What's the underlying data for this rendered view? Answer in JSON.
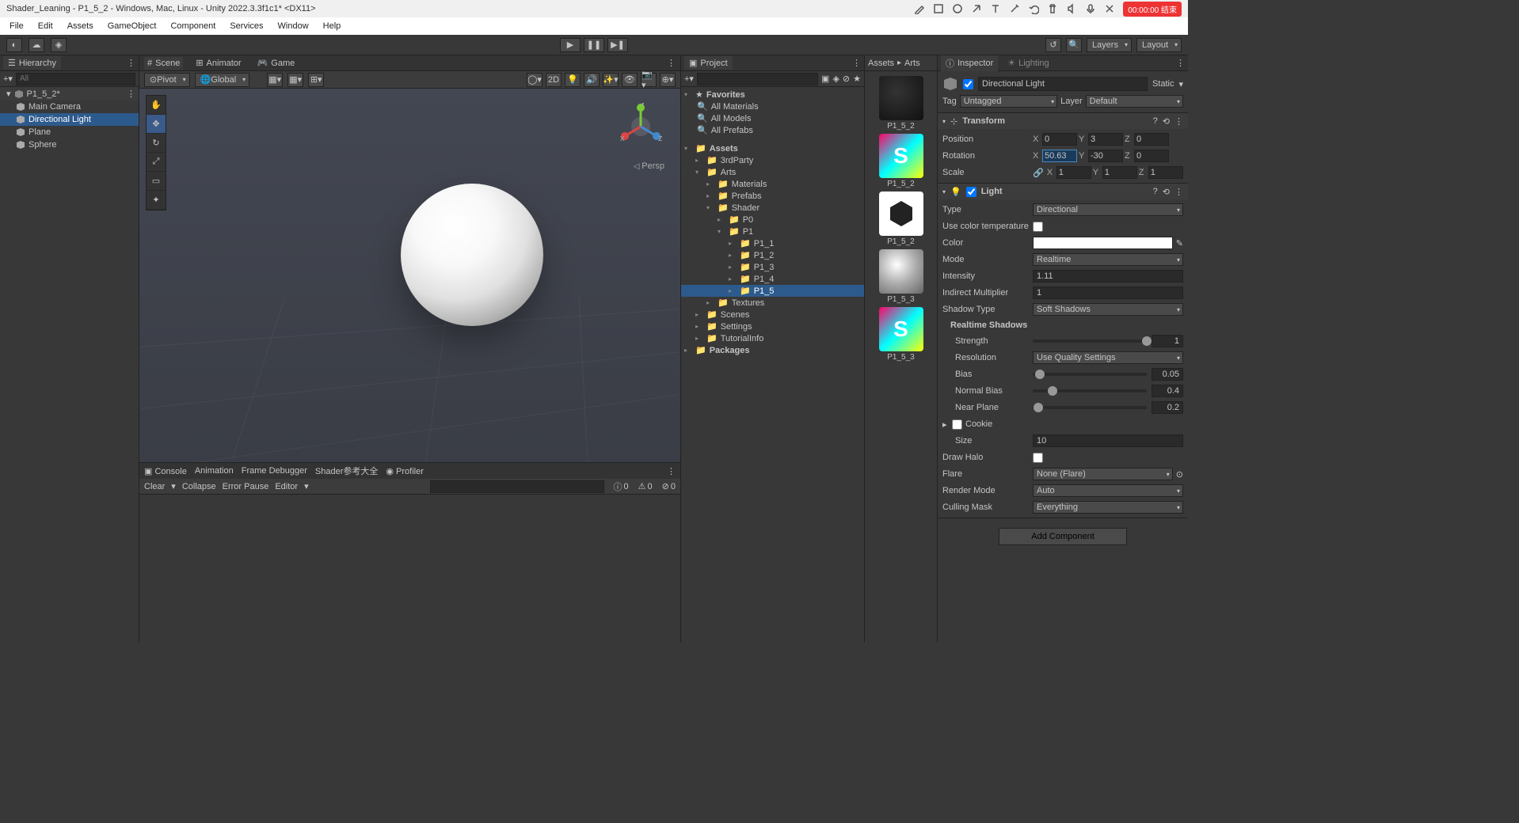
{
  "title": "Shader_Leaning - P1_5_2 - Windows, Mac, Linux - Unity 2022.3.3f1c1* <DX11>",
  "rec": "00:00:00 结束",
  "menu": [
    "File",
    "Edit",
    "Assets",
    "GameObject",
    "Component",
    "Services",
    "Window",
    "Help"
  ],
  "toolbar": {
    "layers": "Layers",
    "layout": "Layout"
  },
  "hierarchy": {
    "tab": "Hierarchy",
    "search": "All",
    "scene": "P1_5_2*",
    "items": [
      "Main Camera",
      "Directional Light",
      "Plane",
      "Sphere"
    ],
    "selected": 1
  },
  "scene": {
    "tabs": [
      "Scene",
      "Animator",
      "Game"
    ],
    "pivot": "Pivot",
    "global": "Global",
    "mode2d": "2D",
    "persp": "Persp"
  },
  "console": {
    "tabs": [
      "Console",
      "Animation",
      "Frame Debugger",
      "Shader参考大全",
      "Profiler"
    ],
    "btns": [
      "Clear",
      "Collapse",
      "Error Pause",
      "Editor"
    ],
    "counts": {
      "info": "0",
      "warn": "0",
      "error": "0"
    }
  },
  "project": {
    "tab": "Project",
    "favorites": "Favorites",
    "fav_items": [
      "All Materials",
      "All Models",
      "All Prefabs"
    ],
    "assets": "Assets",
    "tree": [
      {
        "name": "3rdParty",
        "depth": 1
      },
      {
        "name": "Arts",
        "depth": 1,
        "open": true
      },
      {
        "name": "Materials",
        "depth": 2
      },
      {
        "name": "Prefabs",
        "depth": 2
      },
      {
        "name": "Shader",
        "depth": 2,
        "open": true
      },
      {
        "name": "P0",
        "depth": 3
      },
      {
        "name": "P1",
        "depth": 3,
        "open": true
      },
      {
        "name": "P1_1",
        "depth": 4
      },
      {
        "name": "P1_2",
        "depth": 4
      },
      {
        "name": "P1_3",
        "depth": 4
      },
      {
        "name": "P1_4",
        "depth": 4
      },
      {
        "name": "P1_5",
        "depth": 4,
        "sel": true
      },
      {
        "name": "Textures",
        "depth": 2
      },
      {
        "name": "Scenes",
        "depth": 1
      },
      {
        "name": "Settings",
        "depth": 1
      },
      {
        "name": "TutorialInfo",
        "depth": 1
      }
    ],
    "packages": "Packages"
  },
  "thumbs": {
    "breadcrumb": [
      "Assets",
      "Arts"
    ],
    "items": [
      "P1_5_2",
      "P1_5_2",
      "P1_5_2",
      "P1_5_3",
      "P1_5_3"
    ]
  },
  "inspector": {
    "tab": "Inspector",
    "lighting_tab": "Lighting",
    "name": "Directional Light",
    "static": "Static",
    "tag_label": "Tag",
    "tag": "Untagged",
    "layer_label": "Layer",
    "layer": "Default",
    "transform": {
      "title": "Transform",
      "position": {
        "label": "Position",
        "x": "0",
        "y": "3",
        "z": "0"
      },
      "rotation": {
        "label": "Rotation",
        "x": "50.63",
        "y": "-30",
        "z": "0"
      },
      "scale": {
        "label": "Scale",
        "x": "1",
        "y": "1",
        "z": "1"
      }
    },
    "light": {
      "title": "Light",
      "type": {
        "label": "Type",
        "value": "Directional"
      },
      "use_color_temp": {
        "label": "Use color temperature"
      },
      "color": {
        "label": "Color"
      },
      "mode": {
        "label": "Mode",
        "value": "Realtime"
      },
      "intensity": {
        "label": "Intensity",
        "value": "1.11"
      },
      "indirect": {
        "label": "Indirect Multiplier",
        "value": "1"
      },
      "shadow_type": {
        "label": "Shadow Type",
        "value": "Soft Shadows"
      },
      "realtime_shadows": "Realtime Shadows",
      "strength": {
        "label": "Strength",
        "value": "1"
      },
      "resolution": {
        "label": "Resolution",
        "value": "Use Quality Settings"
      },
      "bias": {
        "label": "Bias",
        "value": "0.05"
      },
      "normal_bias": {
        "label": "Normal Bias",
        "value": "0.4"
      },
      "near_plane": {
        "label": "Near Plane",
        "value": "0.2"
      },
      "cookie": {
        "label": "Cookie"
      },
      "size": {
        "label": "Size",
        "value": "10"
      },
      "draw_halo": {
        "label": "Draw Halo"
      },
      "flare": {
        "label": "Flare",
        "value": "None (Flare)"
      },
      "render_mode": {
        "label": "Render Mode",
        "value": "Auto"
      },
      "culling_mask": {
        "label": "Culling Mask",
        "value": "Everything"
      }
    },
    "add_component": "Add Component"
  }
}
